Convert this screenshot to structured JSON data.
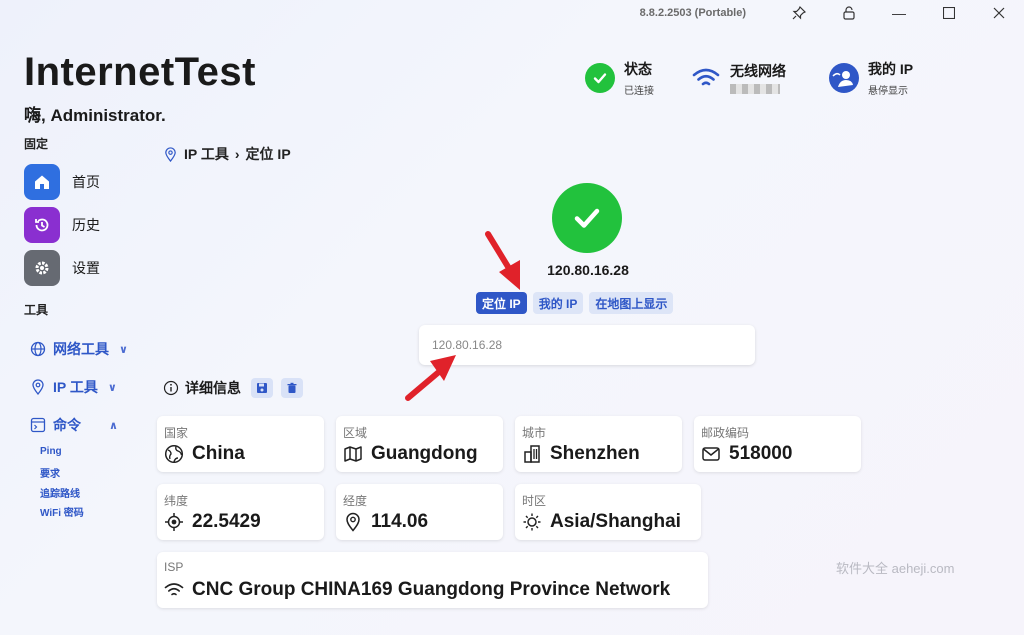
{
  "window": {
    "version": "8.8.2.2503 (Portable)"
  },
  "app": {
    "title": "InternetTest",
    "greeting": "嗨, Administrator."
  },
  "status": {
    "state_label": "状态",
    "state_value": "已连接",
    "wifi_label": "无线网络",
    "myip_label": "我的 IP",
    "myip_value": "悬停显示"
  },
  "sidebar": {
    "pinned_label": "固定",
    "pinned": [
      {
        "label": "首页",
        "icon": "home-icon",
        "color": "#2f6fe0"
      },
      {
        "label": "历史",
        "icon": "history-icon",
        "color": "#8a2fd0"
      },
      {
        "label": "设置",
        "icon": "gear-icon",
        "color": "#666a72"
      }
    ],
    "tools_label": "工具",
    "tools": [
      {
        "label": "网络工具",
        "icon": "globe-icon",
        "chevron": "∨"
      },
      {
        "label": "IP 工具",
        "icon": "location-pin-icon",
        "chevron": "∨"
      },
      {
        "label": "命令",
        "icon": "command-icon",
        "chevron": "∧"
      }
    ],
    "commands": [
      "Ping",
      "要求",
      "追踪路线",
      "WiFi 密码"
    ]
  },
  "breadcrumb": {
    "section": "IP 工具",
    "separator": "›",
    "page": "定位 IP"
  },
  "result": {
    "ip": "120.80.16.28",
    "tabs": [
      "定位 IP",
      "我的 IP",
      "在地图上显示"
    ],
    "active_tab": 0,
    "input_placeholder": "120.80.16.28"
  },
  "details": {
    "label": "详细信息",
    "fields": {
      "country": {
        "key": "国家",
        "value": "China",
        "icon": "globe-icon"
      },
      "region": {
        "key": "区域",
        "value": "Guangdong",
        "icon": "map-icon"
      },
      "city": {
        "key": "城市",
        "value": "Shenzhen",
        "icon": "building-icon"
      },
      "zip": {
        "key": "邮政编码",
        "value": "518000",
        "icon": "mail-icon"
      },
      "lat": {
        "key": "纬度",
        "value": "22.5429",
        "icon": "crosshair-icon"
      },
      "lon": {
        "key": "经度",
        "value": "114.06",
        "icon": "location-pin-icon"
      },
      "tz": {
        "key": "时区",
        "value": "Asia/Shanghai",
        "icon": "sun-icon"
      },
      "isp": {
        "key": "ISP",
        "value": "CNC Group CHINA169 Guangdong Province Network",
        "icon": "wifi-icon"
      }
    }
  },
  "watermark": "软件大全 aeheji.com",
  "colors": {
    "accent": "#2f57c7",
    "success": "#22c23d",
    "arrow": "#e0222a"
  }
}
